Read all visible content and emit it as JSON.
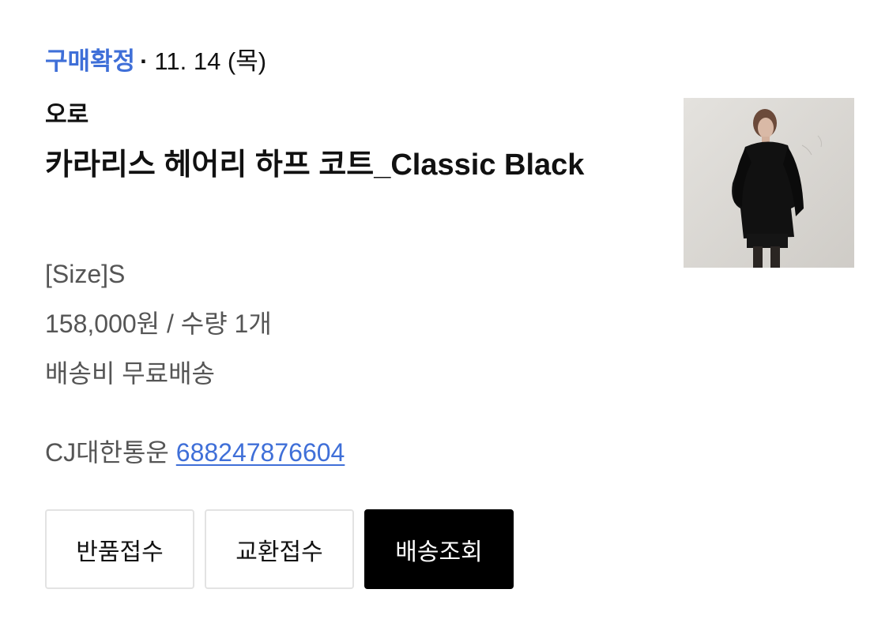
{
  "order": {
    "status_label": "구매확정",
    "separator": "·",
    "date": "11. 14 (목)"
  },
  "product": {
    "brand": "오로",
    "name": "카라리스 헤어리 하프 코트_Classic Black",
    "option": "[Size]S",
    "price_qty": "158,000원 / 수량 1개",
    "shipping": "배송비 무료배송",
    "image_alt": "카라리스 헤어리 하프 코트_Classic Black"
  },
  "delivery": {
    "carrier": "CJ대한통운",
    "tracking_number": "688247876604"
  },
  "actions": {
    "return_label": "반품접수",
    "exchange_label": "교환접수",
    "track_label": "배송조회"
  },
  "colors": {
    "accent": "#3f6fd8",
    "primary_button": "#000000"
  }
}
